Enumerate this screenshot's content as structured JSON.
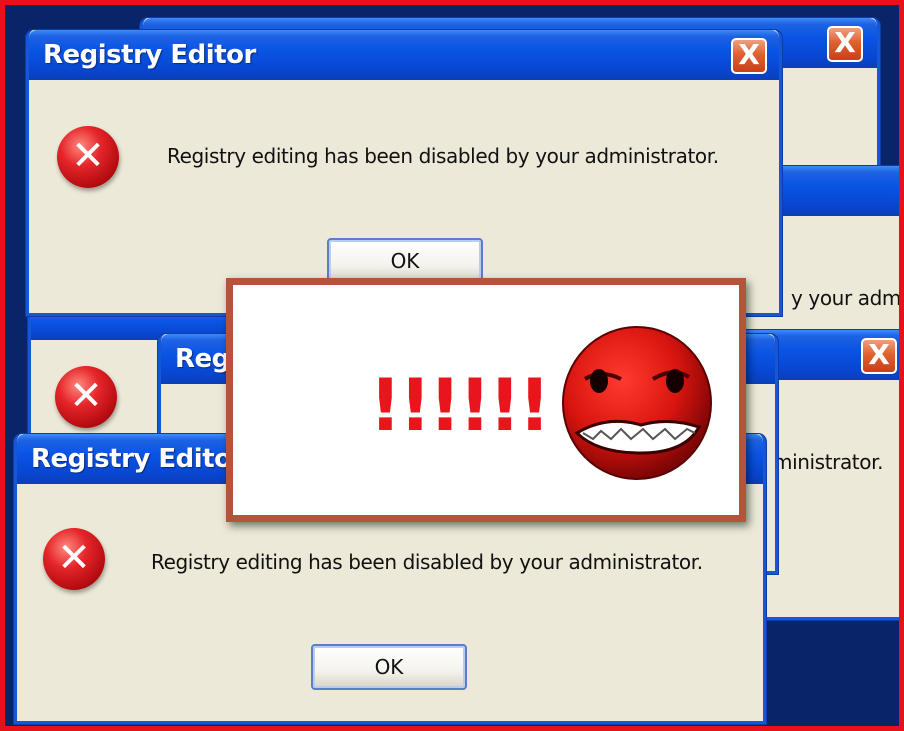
{
  "dialog": {
    "title": "Registry Editor",
    "message": "Registry editing has been disabled by your administrator.",
    "ok_label": "OK",
    "close_glyph": "X",
    "error_glyph": "✕"
  },
  "fragments": {
    "right_partial": "y your adm",
    "right_partial_2": "ministrator.",
    "mid_partial_title": "Regi"
  },
  "alert": {
    "exclamation": "!!!!!!",
    "face_icon": "angry-face-icon"
  },
  "colors": {
    "titlebar": "#0a54e4",
    "dialog_bg": "#ece9d8",
    "error_red": "#e5262a",
    "outer_border": "#e8101a",
    "alert_border": "#b5533b"
  }
}
